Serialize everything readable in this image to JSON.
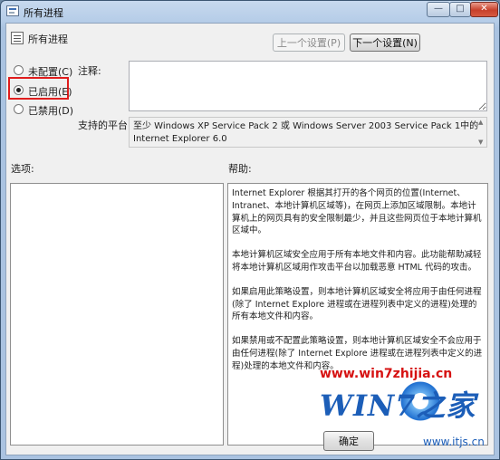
{
  "window": {
    "title": "所有进程",
    "controls": {
      "minimize": "—",
      "maximize": "□",
      "close": "✕"
    }
  },
  "header": {
    "policy_name": "所有进程",
    "prev_button": "上一个设置(P)",
    "next_button": "下一个设置(N)"
  },
  "state": {
    "options": [
      {
        "label": "未配置(C)",
        "checked": false
      },
      {
        "label": "已启用(E)",
        "checked": true
      },
      {
        "label": "已禁用(D)",
        "checked": false
      }
    ]
  },
  "labels": {
    "comment": "注释:",
    "supported_on": "支持的平台:",
    "options": "选项:",
    "help": "帮助:"
  },
  "comment_value": "",
  "supported_platform": "至少 Windows XP Service Pack 2 或 Windows Server 2003 Service Pack 1中的 Internet Explorer 6.0",
  "help_paragraphs": [
    "Internet Explorer 根据其打开的各个网页的位置(Internet、Intranet、本地计算机区域等)，在网页上添加区域限制。本地计算机上的网页具有的安全限制最少，并且这些网页位于本地计算机区域中。",
    "本地计算机区域安全应用于所有本地文件和内容。此功能帮助减轻将本地计算机区域用作攻击平台以加载恶意 HTML 代码的攻击。",
    "如果启用此策略设置，则本地计算机区域安全将应用于由任何进程(除了 Internet Explore 进程或在进程列表中定义的进程)处理的所有本地文件和内容。",
    "如果禁用或不配置此策略设置，则本地计算机区域安全不会应用于由任何进程(除了 Internet Explore 进程或在进程列表中定义的进程)处理的本地文件和内容。"
  ],
  "footer": {
    "ok_button": "确定"
  },
  "watermark": {
    "url": "www.win7zhijia.cn",
    "logo": "WIN7之家",
    "site": "www.itjs.cn"
  },
  "colors": {
    "highlight_border": "#e01d1d",
    "watermark_red": "#d61212",
    "watermark_blue": "#1c5eb8"
  }
}
